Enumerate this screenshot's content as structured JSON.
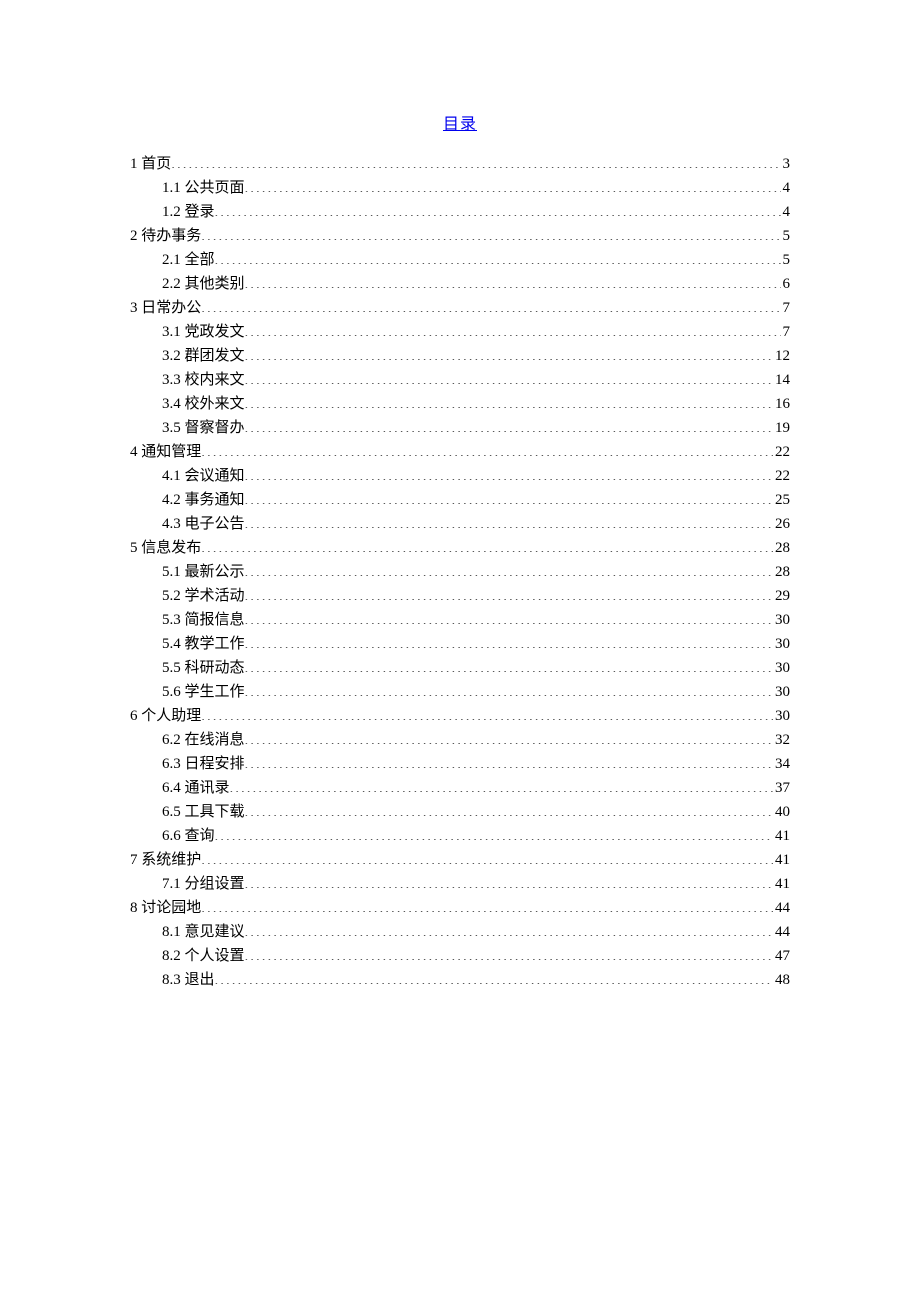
{
  "title": "目录",
  "toc": [
    {
      "level": 1,
      "label": "1 首页",
      "page": "3"
    },
    {
      "level": 2,
      "label": "1.1 公共页面",
      "page": "4"
    },
    {
      "level": 2,
      "label": "1.2 登录",
      "page": "4"
    },
    {
      "level": 1,
      "label": "2 待办事务 ",
      "page": "5"
    },
    {
      "level": 2,
      "label": "2.1 全部",
      "page": "5"
    },
    {
      "level": 2,
      "label": "2.2 其他类别",
      "page": "6"
    },
    {
      "level": 1,
      "label": "3 日常办公 ",
      "page": "7"
    },
    {
      "level": 2,
      "label": "3.1 党政发文",
      "page": "7"
    },
    {
      "level": 2,
      "label": "3.2 群团发文",
      "page": "12"
    },
    {
      "level": 2,
      "label": "3.3 校内来文",
      "page": "14"
    },
    {
      "level": 2,
      "label": "3.4 校外来文",
      "page": "16"
    },
    {
      "level": 2,
      "label": "3.5 督察督办",
      "page": "19"
    },
    {
      "level": 1,
      "label": "4 通知管理 ",
      "page": "22"
    },
    {
      "level": 2,
      "label": "4.1 会议通知",
      "page": "22"
    },
    {
      "level": 2,
      "label": "4.2 事务通知",
      "page": "25"
    },
    {
      "level": 2,
      "label": "4.3 电子公告",
      "page": "26"
    },
    {
      "level": 1,
      "label": "5 信息发布 ",
      "page": "28"
    },
    {
      "level": 2,
      "label": "5.1 最新公示",
      "page": "28"
    },
    {
      "level": 2,
      "label": "5.2 学术活动",
      "page": "29"
    },
    {
      "level": 2,
      "label": "5.3 简报信息",
      "page": "30"
    },
    {
      "level": 2,
      "label": "5.4 教学工作",
      "page": "30"
    },
    {
      "level": 2,
      "label": "5.5 科研动态",
      "page": "30"
    },
    {
      "level": 2,
      "label": "5.6 学生工作",
      "page": "30"
    },
    {
      "level": 1,
      "label": "6 个人助理 ",
      "page": "30"
    },
    {
      "level": 2,
      "label": "6.2 在线消息",
      "page": "32"
    },
    {
      "level": 2,
      "label": "6.3 日程安排",
      "page": "34"
    },
    {
      "level": 2,
      "label": "6.4 通讯录",
      "page": "37"
    },
    {
      "level": 2,
      "label": "6.5 工具下载",
      "page": "40"
    },
    {
      "level": 2,
      "label": "6.6 查询",
      "page": "41"
    },
    {
      "level": 1,
      "label": "7 系统维护 ",
      "page": "41"
    },
    {
      "level": 2,
      "label": "7.1 分组设置",
      "page": "41"
    },
    {
      "level": 1,
      "label": "8 讨论园地 ",
      "page": "44"
    },
    {
      "level": 2,
      "label": "8.1 意见建议",
      "page": "44"
    },
    {
      "level": 2,
      "label": "8.2 个人设置",
      "page": "47"
    },
    {
      "level": 2,
      "label": "8.3 退出",
      "page": "48"
    }
  ]
}
